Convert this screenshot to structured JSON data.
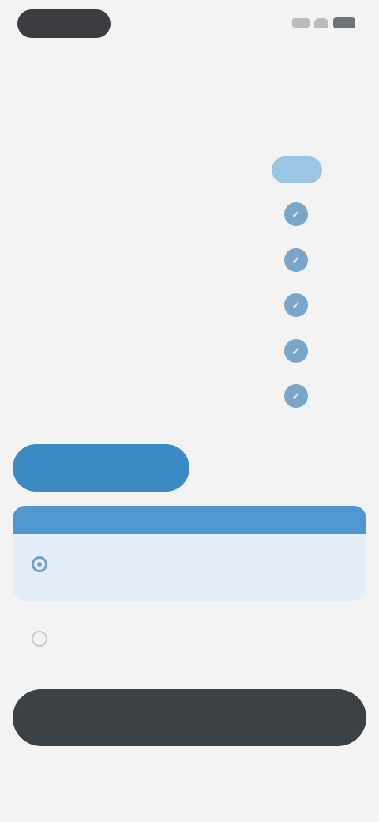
{
  "status_bar": {},
  "title": "",
  "comparison": {
    "free_header": "",
    "pro_header": "",
    "features": [
      {
        "label": "",
        "free": "",
        "pro": "✓"
      },
      {
        "label": "",
        "free": "",
        "pro": "✓"
      },
      {
        "label": "",
        "free": "",
        "pro": "✓"
      },
      {
        "label": "",
        "free": "",
        "pro": "✓"
      },
      {
        "label": "",
        "free": "",
        "pro": "✓"
      }
    ]
  },
  "plan_toggle": {
    "active": "",
    "inactive": ""
  },
  "offer": {
    "banner": "",
    "name": "",
    "subtitle": "",
    "price": ""
  },
  "alt_plan": {
    "name": "",
    "old_price": "",
    "new_price": ""
  },
  "cta_label": "",
  "footer": {
    "link1": "",
    "link2": "",
    "link3": ""
  },
  "colors": {
    "accent": "#3a8bc4",
    "cta": "#3c4146",
    "sale": "#d96a5c"
  }
}
